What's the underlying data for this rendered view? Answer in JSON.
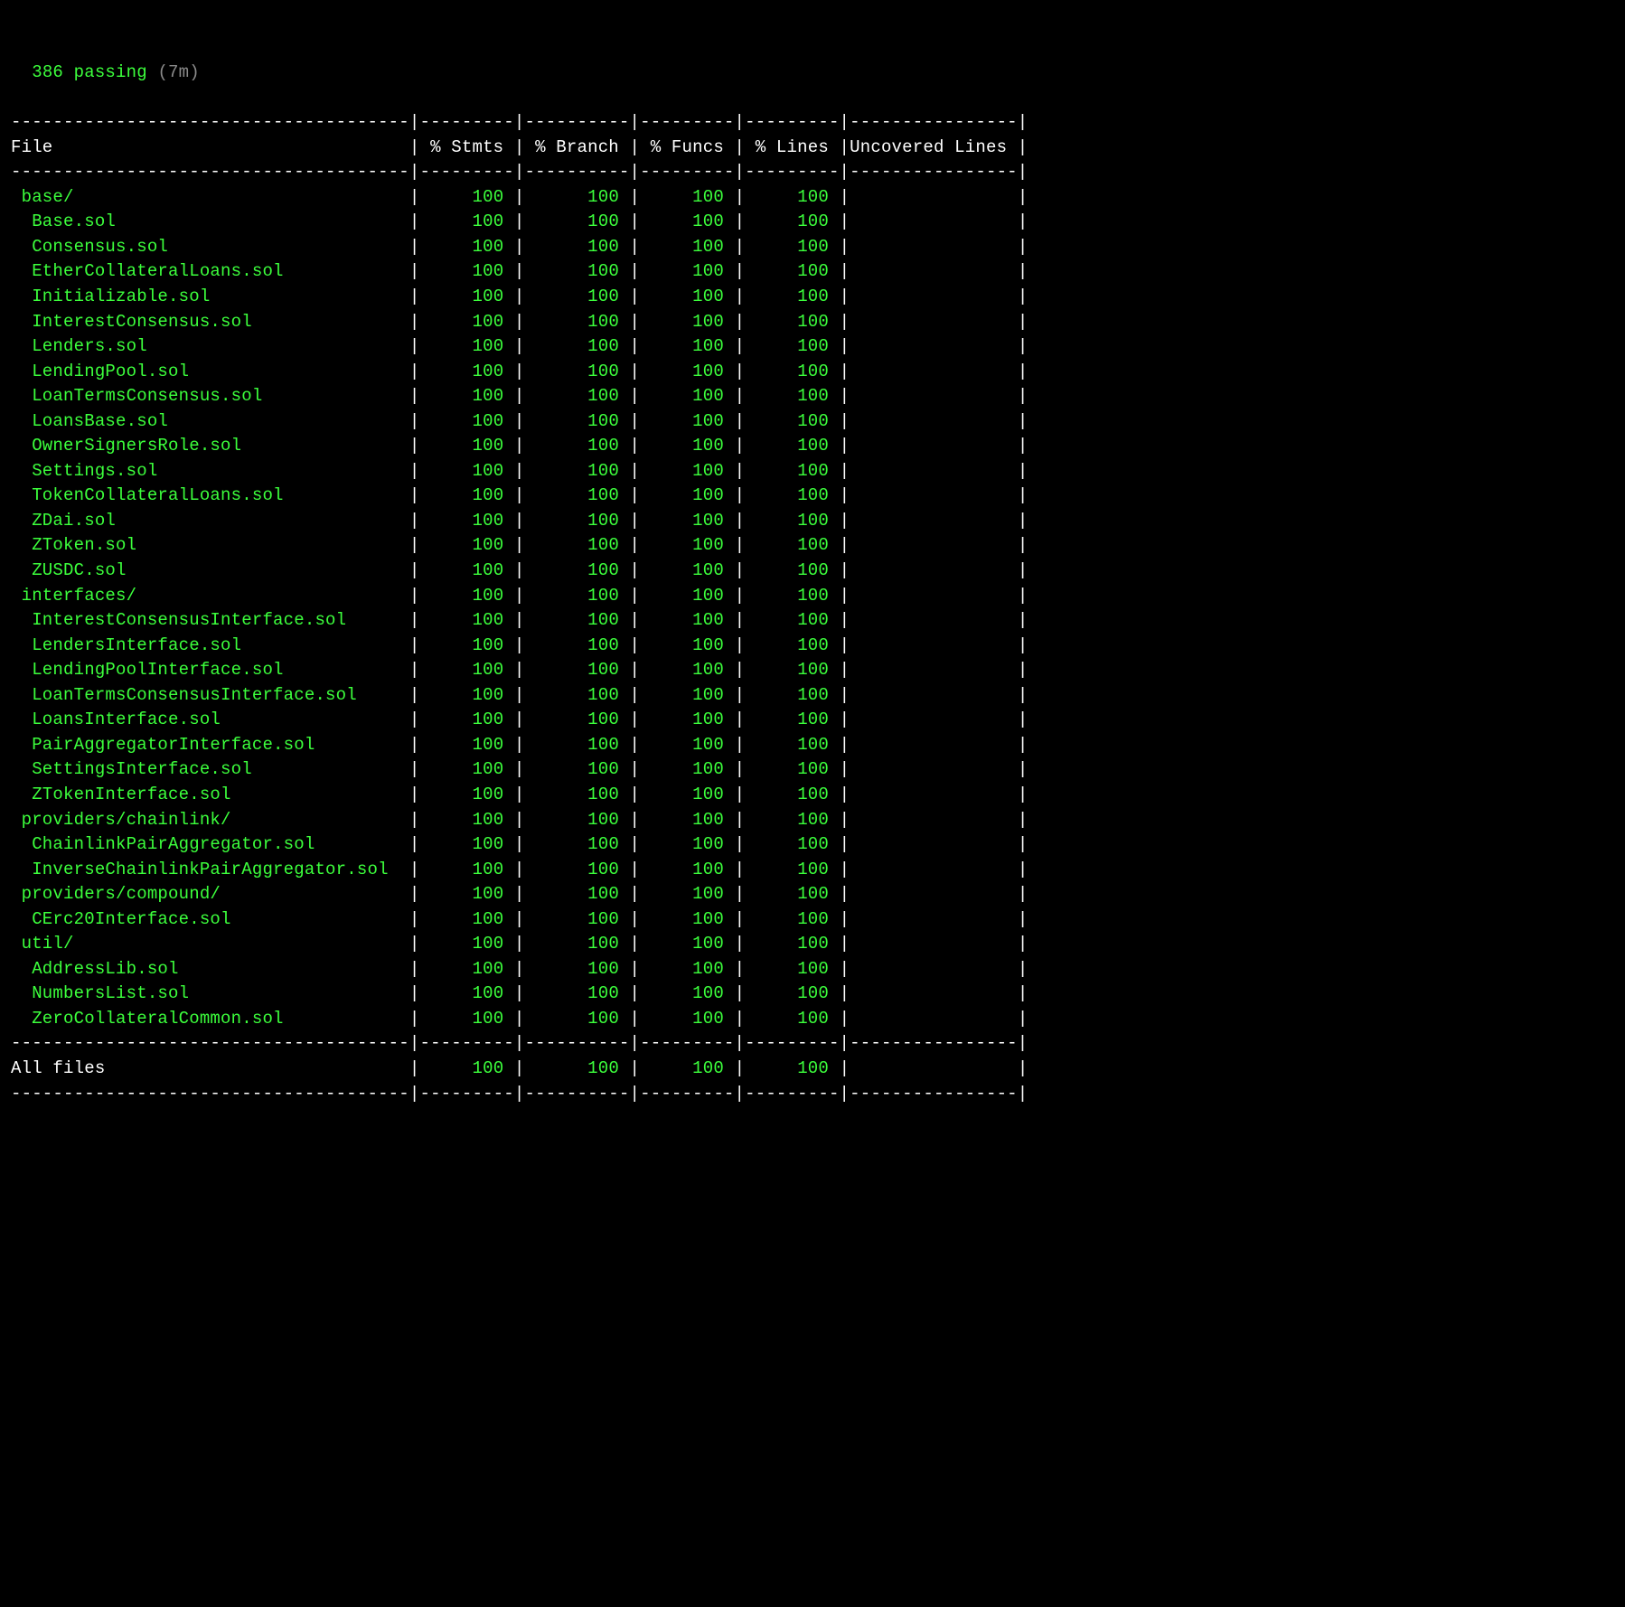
{
  "header": {
    "passing_count": "386",
    "passing_word": "passing",
    "duration": "(7m)"
  },
  "columns": {
    "file": "File",
    "stmts": "% Stmts",
    "branch": "% Branch",
    "funcs": "% Funcs",
    "lines": "% Lines",
    "uncovered": "Uncovered Lines"
  },
  "rows": [
    {
      "indent": 1,
      "file": "base/",
      "stmts": "100",
      "branch": "100",
      "funcs": "100",
      "lines": "100",
      "uncovered": ""
    },
    {
      "indent": 2,
      "file": "Base.sol",
      "stmts": "100",
      "branch": "100",
      "funcs": "100",
      "lines": "100",
      "uncovered": ""
    },
    {
      "indent": 2,
      "file": "Consensus.sol",
      "stmts": "100",
      "branch": "100",
      "funcs": "100",
      "lines": "100",
      "uncovered": ""
    },
    {
      "indent": 2,
      "file": "EtherCollateralLoans.sol",
      "stmts": "100",
      "branch": "100",
      "funcs": "100",
      "lines": "100",
      "uncovered": ""
    },
    {
      "indent": 2,
      "file": "Initializable.sol",
      "stmts": "100",
      "branch": "100",
      "funcs": "100",
      "lines": "100",
      "uncovered": ""
    },
    {
      "indent": 2,
      "file": "InterestConsensus.sol",
      "stmts": "100",
      "branch": "100",
      "funcs": "100",
      "lines": "100",
      "uncovered": ""
    },
    {
      "indent": 2,
      "file": "Lenders.sol",
      "stmts": "100",
      "branch": "100",
      "funcs": "100",
      "lines": "100",
      "uncovered": ""
    },
    {
      "indent": 2,
      "file": "LendingPool.sol",
      "stmts": "100",
      "branch": "100",
      "funcs": "100",
      "lines": "100",
      "uncovered": ""
    },
    {
      "indent": 2,
      "file": "LoanTermsConsensus.sol",
      "stmts": "100",
      "branch": "100",
      "funcs": "100",
      "lines": "100",
      "uncovered": ""
    },
    {
      "indent": 2,
      "file": "LoansBase.sol",
      "stmts": "100",
      "branch": "100",
      "funcs": "100",
      "lines": "100",
      "uncovered": ""
    },
    {
      "indent": 2,
      "file": "OwnerSignersRole.sol",
      "stmts": "100",
      "branch": "100",
      "funcs": "100",
      "lines": "100",
      "uncovered": ""
    },
    {
      "indent": 2,
      "file": "Settings.sol",
      "stmts": "100",
      "branch": "100",
      "funcs": "100",
      "lines": "100",
      "uncovered": ""
    },
    {
      "indent": 2,
      "file": "TokenCollateralLoans.sol",
      "stmts": "100",
      "branch": "100",
      "funcs": "100",
      "lines": "100",
      "uncovered": ""
    },
    {
      "indent": 2,
      "file": "ZDai.sol",
      "stmts": "100",
      "branch": "100",
      "funcs": "100",
      "lines": "100",
      "uncovered": ""
    },
    {
      "indent": 2,
      "file": "ZToken.sol",
      "stmts": "100",
      "branch": "100",
      "funcs": "100",
      "lines": "100",
      "uncovered": ""
    },
    {
      "indent": 2,
      "file": "ZUSDC.sol",
      "stmts": "100",
      "branch": "100",
      "funcs": "100",
      "lines": "100",
      "uncovered": ""
    },
    {
      "indent": 1,
      "file": "interfaces/",
      "stmts": "100",
      "branch": "100",
      "funcs": "100",
      "lines": "100",
      "uncovered": ""
    },
    {
      "indent": 2,
      "file": "InterestConsensusInterface.sol",
      "stmts": "100",
      "branch": "100",
      "funcs": "100",
      "lines": "100",
      "uncovered": ""
    },
    {
      "indent": 2,
      "file": "LendersInterface.sol",
      "stmts": "100",
      "branch": "100",
      "funcs": "100",
      "lines": "100",
      "uncovered": ""
    },
    {
      "indent": 2,
      "file": "LendingPoolInterface.sol",
      "stmts": "100",
      "branch": "100",
      "funcs": "100",
      "lines": "100",
      "uncovered": ""
    },
    {
      "indent": 2,
      "file": "LoanTermsConsensusInterface.sol",
      "stmts": "100",
      "branch": "100",
      "funcs": "100",
      "lines": "100",
      "uncovered": ""
    },
    {
      "indent": 2,
      "file": "LoansInterface.sol",
      "stmts": "100",
      "branch": "100",
      "funcs": "100",
      "lines": "100",
      "uncovered": ""
    },
    {
      "indent": 2,
      "file": "PairAggregatorInterface.sol",
      "stmts": "100",
      "branch": "100",
      "funcs": "100",
      "lines": "100",
      "uncovered": ""
    },
    {
      "indent": 2,
      "file": "SettingsInterface.sol",
      "stmts": "100",
      "branch": "100",
      "funcs": "100",
      "lines": "100",
      "uncovered": ""
    },
    {
      "indent": 2,
      "file": "ZTokenInterface.sol",
      "stmts": "100",
      "branch": "100",
      "funcs": "100",
      "lines": "100",
      "uncovered": ""
    },
    {
      "indent": 1,
      "file": "providers/chainlink/",
      "stmts": "100",
      "branch": "100",
      "funcs": "100",
      "lines": "100",
      "uncovered": ""
    },
    {
      "indent": 2,
      "file": "ChainlinkPairAggregator.sol",
      "stmts": "100",
      "branch": "100",
      "funcs": "100",
      "lines": "100",
      "uncovered": ""
    },
    {
      "indent": 2,
      "file": "InverseChainlinkPairAggregator.sol",
      "stmts": "100",
      "branch": "100",
      "funcs": "100",
      "lines": "100",
      "uncovered": ""
    },
    {
      "indent": 1,
      "file": "providers/compound/",
      "stmts": "100",
      "branch": "100",
      "funcs": "100",
      "lines": "100",
      "uncovered": ""
    },
    {
      "indent": 2,
      "file": "CErc20Interface.sol",
      "stmts": "100",
      "branch": "100",
      "funcs": "100",
      "lines": "100",
      "uncovered": ""
    },
    {
      "indent": 1,
      "file": "util/",
      "stmts": "100",
      "branch": "100",
      "funcs": "100",
      "lines": "100",
      "uncovered": ""
    },
    {
      "indent": 2,
      "file": "AddressLib.sol",
      "stmts": "100",
      "branch": "100",
      "funcs": "100",
      "lines": "100",
      "uncovered": ""
    },
    {
      "indent": 2,
      "file": "NumbersList.sol",
      "stmts": "100",
      "branch": "100",
      "funcs": "100",
      "lines": "100",
      "uncovered": ""
    },
    {
      "indent": 2,
      "file": "ZeroCollateralCommon.sol",
      "stmts": "100",
      "branch": "100",
      "funcs": "100",
      "lines": "100",
      "uncovered": ""
    }
  ],
  "footer": {
    "label": "All files",
    "stmts": "100",
    "branch": "100",
    "funcs": "100",
    "lines": "100",
    "uncovered": ""
  },
  "widths": {
    "file": 38,
    "stmts": 9,
    "branch": 10,
    "funcs": 9,
    "lines": 9,
    "uncovered": 16
  }
}
